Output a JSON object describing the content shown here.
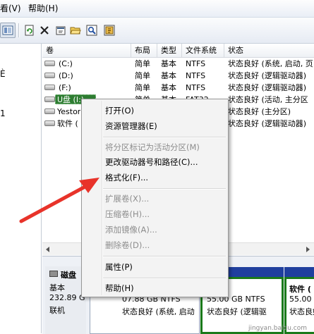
{
  "menubar": {
    "view": "看(V)",
    "help": "帮助(H)"
  },
  "toolbar": {
    "buttons": [
      "refresh-icon",
      "delete-icon",
      "properties-icon",
      "open-folder-icon",
      "search-icon",
      "help-icon"
    ]
  },
  "left_pane": {
    "frag1": "È",
    "frag2": "1"
  },
  "volume_list": {
    "columns": [
      "卷",
      "布局",
      "类型",
      "文件系统",
      "状态"
    ],
    "rows": [
      {
        "name": "(C:)",
        "layout": "简单",
        "type": "基本",
        "fs": "NTFS",
        "status": "状态良好 (系统, 启动, 页"
      },
      {
        "name": "(D:)",
        "layout": "简单",
        "type": "基本",
        "fs": "NTFS",
        "status": "状态良好 (逻辑驱动器)"
      },
      {
        "name": "(F:)",
        "layout": "简单",
        "type": "基本",
        "fs": "NTFS",
        "status": "状态良好 (逻辑驱动器)"
      },
      {
        "name": "U盘 (I:)",
        "layout": "简单",
        "type": "基本",
        "fs": "FAT32",
        "status": "状态良好 (活动, 主分区"
      },
      {
        "name": "Yestor",
        "layout": "",
        "type": "",
        "fs": "",
        "status": "状态良好 (主分区)"
      },
      {
        "name": "软件 (",
        "layout": "",
        "type": "",
        "fs": "",
        "status": "状态良好 (逻辑驱动器)"
      }
    ]
  },
  "context_menu": {
    "items": [
      {
        "label": "打开(O)",
        "enabled": true
      },
      {
        "label": "资源管理器(E)",
        "enabled": true
      },
      {
        "label": "将分区标记为活动分区(M)",
        "enabled": false
      },
      {
        "label": "更改驱动器号和路径(C)...",
        "enabled": true
      },
      {
        "label": "格式化(F)...",
        "enabled": true
      },
      {
        "label": "扩展卷(X)...",
        "enabled": false
      },
      {
        "label": "压缩卷(H)...",
        "enabled": false
      },
      {
        "label": "添加镜像(A)...",
        "enabled": false
      },
      {
        "label": "删除卷(D)...",
        "enabled": false
      },
      {
        "label": "属性(P)",
        "enabled": true
      },
      {
        "label": "帮助(H)",
        "enabled": true
      }
    ]
  },
  "disk": {
    "name": "磁盘",
    "kind": "基本",
    "size": "232.89 G",
    "status": "联机",
    "partitions": [
      {
        "size": "07.88 GB NTFS",
        "status": "状态良好 (系统, 启动"
      },
      {
        "size": "55.00 GB NTFS",
        "status": "状态良好 (逻辑驱"
      },
      {
        "name": "软件 (",
        "size": "55.00 G",
        "status": "状态良好"
      }
    ]
  },
  "colors": {
    "primary_partition": "#1f3f9e",
    "logical_partition": "#1a7a1a",
    "arrow": "#e8332a"
  },
  "watermark": "jingyan.baidu.com"
}
